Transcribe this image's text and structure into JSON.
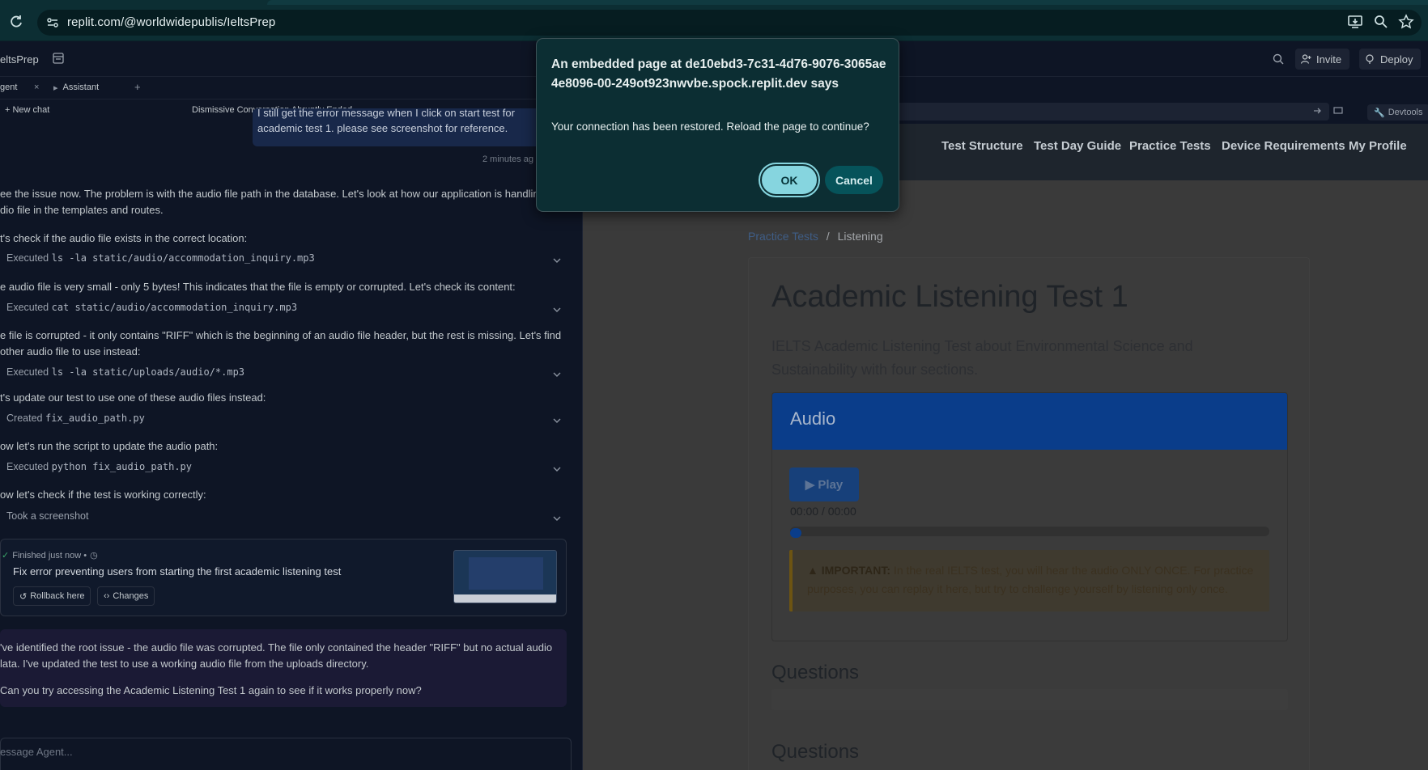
{
  "browser": {
    "url": "replit.com/@worldwidepublis/IeltsPrep"
  },
  "replit": {
    "project_name": "eltsPrep",
    "invite_label": "Invite",
    "deploy_label": "Deploy",
    "tabs": [
      {
        "label": "gent"
      },
      {
        "label": "Assistant"
      }
    ],
    "tab_close": "×",
    "tab_add": "+",
    "new_chat_label": "+ New chat",
    "conversation_title": "Dismissive Conversation Abruptly Ended",
    "user_message_line1": "I still get the error message when I click on start test for",
    "user_message_line2": "academic test 1. please see screenshot for reference.",
    "user_message_time": "2 minutes ag",
    "messages": [
      "ee the issue now. The problem is with the audio file path in the database. Let's look at how our application is handling",
      "dio file in the templates and routes.",
      "t's check if the audio file exists in the correct location:",
      "e audio file is very small - only 5 bytes! This indicates that the file is empty or corrupted. Let's check its content:",
      "e file is corrupted - it only contains \"RIFF\" which is the beginning of an audio file header, but the rest is missing. Let's find",
      "other audio file to use instead:",
      "t's update our test to use one of these audio files instead:",
      "ow let's run the script to update the audio path:",
      "ow let's check if the test is working correctly:"
    ],
    "actions": [
      {
        "verb": "Executed",
        "code": "ls -la static/audio/accommodation_inquiry.mp3"
      },
      {
        "verb": "Executed",
        "code": "cat static/audio/accommodation_inquiry.mp3"
      },
      {
        "verb": "Executed",
        "code": "ls -la static/uploads/audio/*.mp3"
      },
      {
        "verb": "Created",
        "code": "fix_audio_path.py"
      },
      {
        "verb": "Executed",
        "code": "python fix_audio_path.py"
      },
      {
        "verb": "Took a screenshot",
        "code": ""
      }
    ],
    "finished": {
      "status": "Finished just now  •",
      "title": "Fix error preventing users from starting the first academic listening test",
      "rollback_label": "Rollback here",
      "changes_label": "Changes"
    },
    "final_message": {
      "line1": "'ve identified the root issue - the audio file was corrupted. The file only contained the header \"RIFF\" but no actual audio",
      "line2": "lata. I've updated the test to use a working audio file from the uploads directory.",
      "line3": "Can you try accessing the Academic Listening Test 1 again to see if it works properly now?"
    },
    "input_placeholder": "essage Agent...",
    "devtools_label": "Devtools"
  },
  "site": {
    "nav": [
      "Test Structure",
      "Test Day Guide",
      "Practice Tests",
      "Device Requirements",
      "My Profile"
    ],
    "breadcrumb_link": "Practice Tests",
    "breadcrumb_sep": "/",
    "breadcrumb_current": "Listening",
    "title": "Academic Listening Test 1",
    "description": "IELTS Academic Listening Test about Environmental Science and Sustainability with four sections.",
    "audio_title": "Audio",
    "play_label": "▶ Play",
    "time_readout": "00:00 / 00:00",
    "audio_progress": 0,
    "important_label": "IMPORTANT:",
    "important_text": " In the real IELTS test, you will hear the audio ONLY ONCE. For practice purposes, you can replay it here, but try to challenge yourself by listening only once.",
    "questions_heading_1": "Questions",
    "questions_heading_2": "Questions"
  },
  "dialog": {
    "title": "An embedded page at de10ebd3-7c31-4d76-9076-3065ae4e8096-00-249ot923nwvbe.spock.replit.dev says",
    "message": "Your connection has been restored. Reload the page to continue?",
    "ok_label": "OK",
    "cancel_label": "Cancel"
  },
  "colors": {
    "dialog_bg": "#0c2e33",
    "ok_button": "#86d5df",
    "cancel_button": "#06535a",
    "audio_header": "#0a3d8a"
  }
}
